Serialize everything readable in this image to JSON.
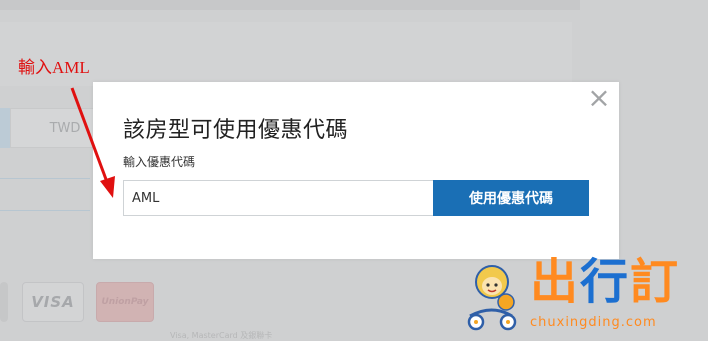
{
  "background": {
    "currency": "TWD",
    "cards": {
      "visa": "VISA",
      "unionpay": "UnionPay"
    },
    "footer_text": "Visa, MasterCard 及銀聯卡"
  },
  "modal": {
    "title": "該房型可使用優惠代碼",
    "label": "輸入優惠代碼",
    "input_value": "AML",
    "button_label": "使用優惠代碼",
    "close_symbol": "×"
  },
  "annotation": {
    "text": "輸入AML",
    "color": "#e01010"
  },
  "watermark": {
    "brand_part1": "出",
    "brand_part2": "行",
    "brand_part3": "訂",
    "url": "chuxingding.com"
  },
  "colors": {
    "accent": "#1a6fb5",
    "overlay": "#cfd0d1",
    "brand_orange": "#ff8a20"
  }
}
